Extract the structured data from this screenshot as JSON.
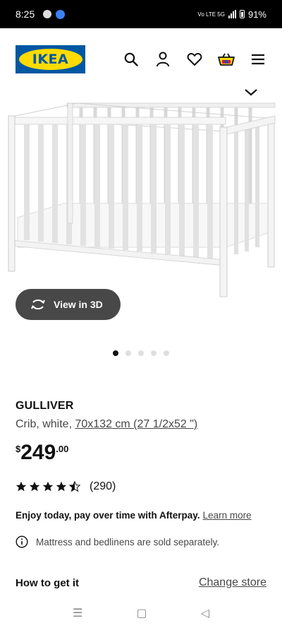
{
  "status_bar": {
    "time": "8:25",
    "network": "Vo LTE 5G",
    "battery": "91%"
  },
  "header": {
    "logo_text": "IKEA",
    "icons": [
      "search-icon",
      "profile-icon",
      "heart-icon",
      "shopping-bag-icon",
      "menu-icon"
    ]
  },
  "gallery": {
    "view_3d_label": "View in 3D",
    "image_count": 5,
    "active_index": 0
  },
  "product": {
    "name": "GULLIVER",
    "description_prefix": "Crib, white, ",
    "size": "70x132 cm (27 1/2x52 \")",
    "price_currency": "$",
    "price_int": "249",
    "price_dec": ".00",
    "rating_value": 4.5,
    "review_count": "(290)"
  },
  "afterpay": {
    "text": "Enjoy today, pay over time with Afterpay.",
    "link": "Learn more"
  },
  "notice": {
    "text": "Mattress and bedlinens are sold separately."
  },
  "fulfillment": {
    "title": "How to get it",
    "change_store": "Change store"
  },
  "nav_bar": {
    "recent": "☰",
    "home": "▢",
    "back": "◁"
  },
  "colors": {
    "ikea_blue": "#0058a3",
    "ikea_yellow": "#ffdb00",
    "button_dark": "#484848"
  }
}
